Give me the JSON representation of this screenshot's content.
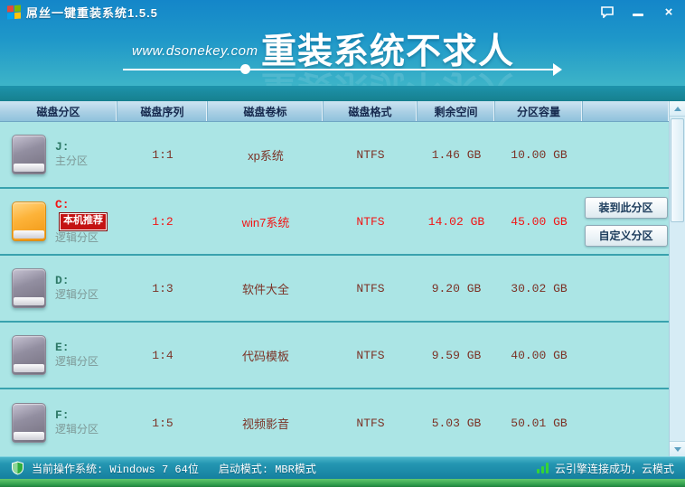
{
  "window": {
    "title": "屌丝一键重装系统1.5.5",
    "controls": {
      "minimize": "minimize",
      "close": "×",
      "feedback": "feedback-bubble"
    }
  },
  "banner": {
    "url": "www.dsonekey.com",
    "slogan": "重装系统不求人"
  },
  "table": {
    "headers": [
      "磁盘分区",
      "磁盘序列",
      "磁盘卷标",
      "磁盘格式",
      "剩余空间",
      "分区容量"
    ],
    "rows": [
      {
        "letter": "J:",
        "type": "主分区",
        "serial": "1:1",
        "label": "xp系统",
        "format": "NTFS",
        "free": "1.46 GB",
        "capacity": "10.00 GB"
      },
      {
        "letter": "C:",
        "type": "逻辑分区",
        "serial": "1:2",
        "label": "win7系统",
        "format": "NTFS",
        "free": "14.02 GB",
        "capacity": "45.00 GB",
        "badge": "本机推荐"
      },
      {
        "letter": "D:",
        "type": "逻辑分区",
        "serial": "1:3",
        "label": "软件大全",
        "format": "NTFS",
        "free": "9.20 GB",
        "capacity": "30.02 GB"
      },
      {
        "letter": "E:",
        "type": "逻辑分区",
        "serial": "1:4",
        "label": "代码模板",
        "format": "NTFS",
        "free": "9.59 GB",
        "capacity": "40.00 GB"
      },
      {
        "letter": "F:",
        "type": "逻辑分区",
        "serial": "1:5",
        "label": "视频影音",
        "format": "NTFS",
        "free": "5.03 GB",
        "capacity": "50.01 GB"
      }
    ],
    "buttons": {
      "install": "装到此分区",
      "custom": "自定义分区"
    }
  },
  "statusbar": {
    "os": "当前操作系统: Windows 7 64位",
    "boot": "启动模式: MBR模式",
    "cloud": "云引擎连接成功，云模式"
  },
  "colors": {
    "header_blue_top": "#1486c9",
    "header_teal_bottom": "#3db4c8",
    "row_cyan": "#abe5e5",
    "recommend_red": "#f21414",
    "value_maroon": "#7b3226",
    "status_green": "#35d435",
    "bottom_green": "#2f9e4d"
  }
}
